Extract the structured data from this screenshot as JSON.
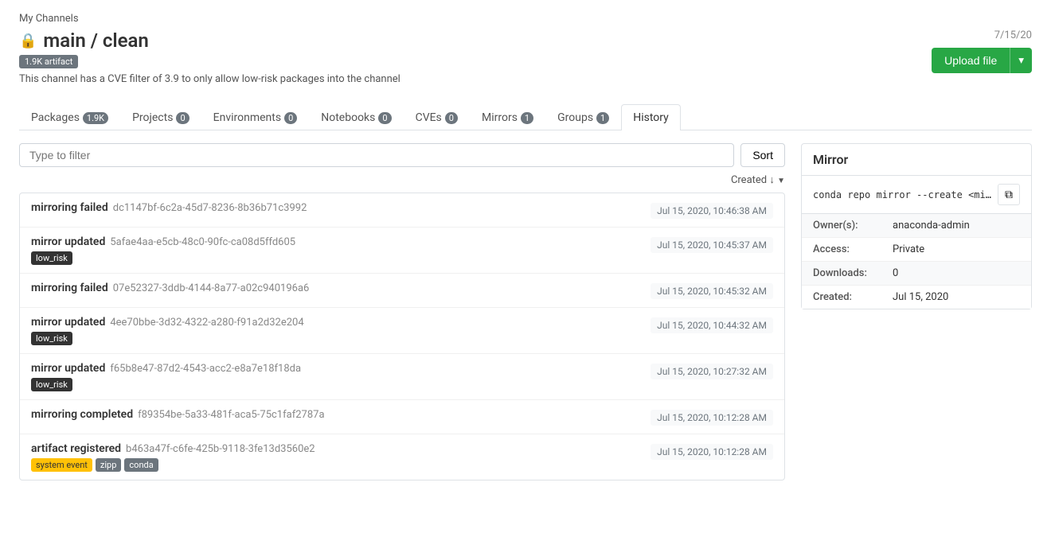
{
  "breadcrumb": "My Channels",
  "channel": {
    "lock": "🔒",
    "title": "main / clean",
    "badge": "1.9K artifact",
    "description": "This channel has a CVE filter of 3.9 to only allow low-risk packages into the channel",
    "date": "7/15/20"
  },
  "upload_btn": "Upload file",
  "tabs": [
    {
      "label": "Packages",
      "badge": "1.9K",
      "active": false
    },
    {
      "label": "Projects",
      "badge": "0",
      "active": false
    },
    {
      "label": "Environments",
      "badge": "0",
      "active": false
    },
    {
      "label": "Notebooks",
      "badge": "0",
      "active": false
    },
    {
      "label": "CVEs",
      "badge": "0",
      "active": false
    },
    {
      "label": "Mirrors",
      "badge": "1",
      "active": false
    },
    {
      "label": "Groups",
      "badge": "1",
      "active": false
    },
    {
      "label": "History",
      "badge": "",
      "active": true
    }
  ],
  "filter": {
    "placeholder": "Type to filter",
    "sort_label": "Sort",
    "sort_direction": "Created ↓"
  },
  "history_items": [
    {
      "event": "mirroring failed",
      "id": "dc1147bf-6c2a-45d7-8236-8b36b71c3992",
      "time": "Jul 15, 2020, 10:46:38 AM",
      "tags": []
    },
    {
      "event": "mirror updated",
      "id": "5afae4aa-e5cb-48c0-90fc-ca08d5ffd605",
      "time": "Jul 15, 2020, 10:45:37 AM",
      "tags": [
        "low_risk"
      ]
    },
    {
      "event": "mirroring failed",
      "id": "07e52327-3ddb-4144-8a77-a02c940196a6",
      "time": "Jul 15, 2020, 10:45:32 AM",
      "tags": []
    },
    {
      "event": "mirror updated",
      "id": "4ee70bbe-3d32-4322-a280-f91a2d32e204",
      "time": "Jul 15, 2020, 10:44:32 AM",
      "tags": [
        "low_risk"
      ]
    },
    {
      "event": "mirror updated",
      "id": "f65b8e47-87d2-4543-acc2-e8a7e18f18da",
      "time": "Jul 15, 2020, 10:27:32 AM",
      "tags": [
        "low_risk"
      ]
    },
    {
      "event": "mirroring completed",
      "id": "f89354be-5a33-481f-aca5-75c1faf2787a",
      "time": "Jul 15, 2020, 10:12:28 AM",
      "tags": []
    },
    {
      "event": "artifact registered",
      "id": "b463a47f-c6fe-425b-9118-3fe13d3560e2",
      "time": "Jul 15, 2020, 10:12:28 AM",
      "tags": [
        "system event",
        "zipp",
        "conda"
      ]
    }
  ],
  "mirror_panel": {
    "title": "Mirror",
    "command": "conda repo mirror --create <mirror_n",
    "details": [
      {
        "label": "Owner(s):",
        "value": "anaconda-admin"
      },
      {
        "label": "Access:",
        "value": "Private"
      },
      {
        "label": "Downloads:",
        "value": "0"
      },
      {
        "label": "Created:",
        "value": "Jul 15, 2020"
      }
    ]
  }
}
